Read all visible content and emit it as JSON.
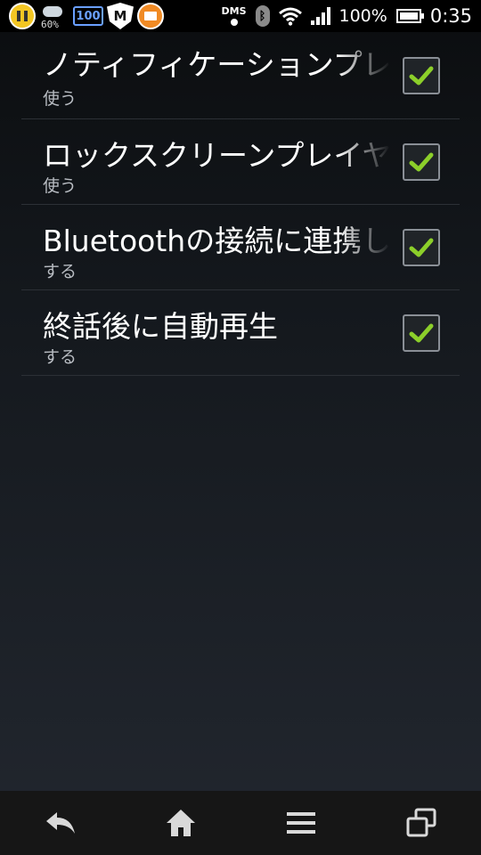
{
  "status_bar": {
    "weather_percent": "60%",
    "battery_app_text": "100",
    "shield_letter": "M",
    "dms_label": "DMS",
    "battery_percent": "100%",
    "time": "0:35"
  },
  "settings": [
    {
      "title": "ノティフィケーションプレイヤー",
      "summary": "使う",
      "checked": true
    },
    {
      "title": "ロックスクリーンプレイヤー",
      "summary": "使う",
      "checked": true
    },
    {
      "title": "Bluetoothの接続に連携して",
      "summary": "する",
      "checked": true
    },
    {
      "title": "終話後に自動再生",
      "summary": "する",
      "checked": true
    }
  ],
  "colors": {
    "checkmark": "#8ccf2a",
    "status_bar_bg": "#000000",
    "nav_bar_bg": "#161616"
  },
  "nav": {
    "icons": [
      "back-icon",
      "home-icon",
      "menu-icon",
      "recent-apps-icon"
    ]
  }
}
